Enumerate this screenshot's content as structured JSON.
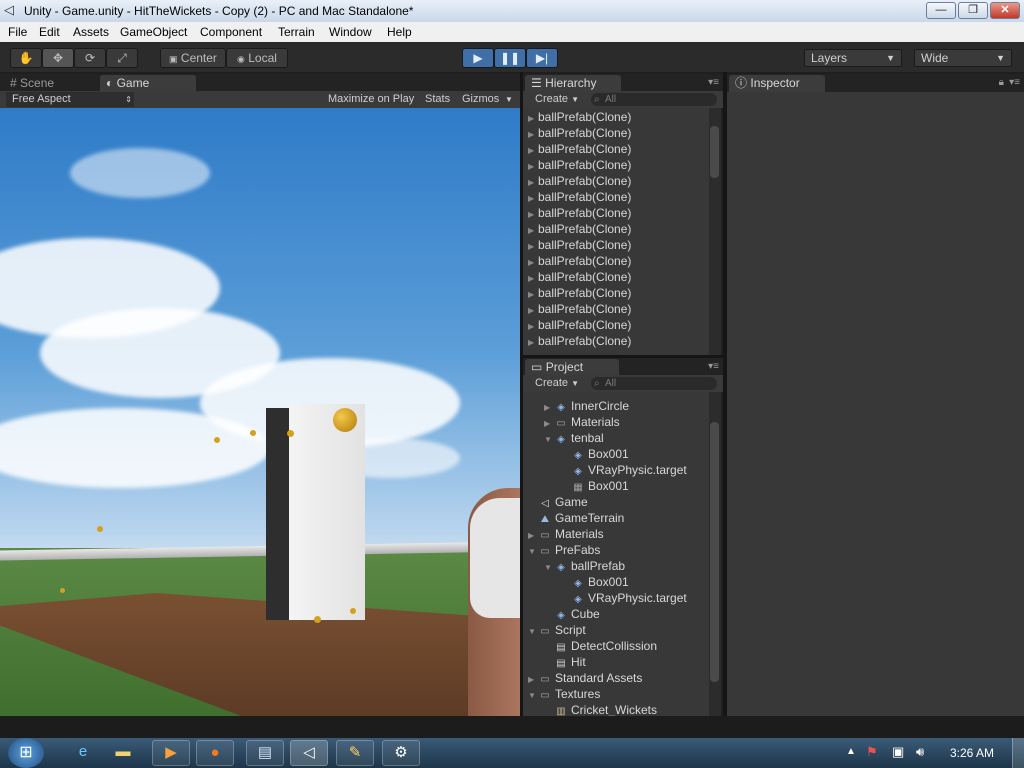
{
  "window": {
    "title": "Unity - Game.unity - HitTheWickets - Copy (2) - PC and Mac Standalone*",
    "min": "—",
    "max": "❐",
    "close": "✕"
  },
  "menu": [
    "File",
    "Edit",
    "Assets",
    "GameObject",
    "Component",
    "Terrain",
    "Window",
    "Help"
  ],
  "toolbar": {
    "center": "Center",
    "local": "Local",
    "layers": "Layers",
    "layout": "Wide"
  },
  "scene_tab": "Scene",
  "game_tab": "Game",
  "game_bar": {
    "aspect": "Free Aspect",
    "maximize": "Maximize on Play",
    "stats": "Stats",
    "gizmos": "Gizmos"
  },
  "hierarchy": {
    "tab": "Hierarchy",
    "create": "Create",
    "search_placeholder": "All",
    "items": [
      "ballPrefab(Clone)",
      "ballPrefab(Clone)",
      "ballPrefab(Clone)",
      "ballPrefab(Clone)",
      "ballPrefab(Clone)",
      "ballPrefab(Clone)",
      "ballPrefab(Clone)",
      "ballPrefab(Clone)",
      "ballPrefab(Clone)",
      "ballPrefab(Clone)",
      "ballPrefab(Clone)",
      "ballPrefab(Clone)",
      "ballPrefab(Clone)",
      "ballPrefab(Clone)",
      "ballPrefab(Clone)"
    ]
  },
  "project": {
    "tab": "Project",
    "create": "Create",
    "search_placeholder": "All",
    "items": [
      {
        "label": "InnerCircle",
        "tri": "▶",
        "icon": "prefab-icon"
      },
      {
        "label": "Materials",
        "tri": "▶",
        "icon": "folder-icon"
      },
      {
        "label": "tenbal",
        "tri": "▼",
        "icon": "prefab-icon"
      },
      {
        "label": "Box001",
        "tri": "",
        "icon": "mesh-icon"
      },
      {
        "label": "VRayPhysic.target",
        "tri": "",
        "icon": "mesh-icon"
      },
      {
        "label": "Box001",
        "tri": "",
        "icon": "grid-icon"
      },
      {
        "label": "Game",
        "tri": "",
        "icon": "unity-scene-icon"
      },
      {
        "label": "GameTerrain",
        "tri": "",
        "icon": "terrain-icon"
      },
      {
        "label": "Materials",
        "tri": "▶",
        "icon": "folder-icon"
      },
      {
        "label": "PreFabs",
        "tri": "▼",
        "icon": "folder-icon"
      },
      {
        "label": "ballPrefab",
        "tri": "▼",
        "icon": "prefab-icon"
      },
      {
        "label": "Box001",
        "tri": "",
        "icon": "mesh-icon"
      },
      {
        "label": "VRayPhysic.target",
        "tri": "",
        "icon": "mesh-icon"
      },
      {
        "label": "Cube",
        "tri": "",
        "icon": "prefab-icon"
      },
      {
        "label": "Script",
        "tri": "▼",
        "icon": "folder-icon"
      },
      {
        "label": "DetectCollission",
        "tri": "",
        "icon": "script-icon"
      },
      {
        "label": "Hit",
        "tri": "",
        "icon": "script-icon"
      },
      {
        "label": "Standard Assets",
        "tri": "▶",
        "icon": "folder-icon"
      },
      {
        "label": "Textures",
        "tri": "▼",
        "icon": "folder-icon"
      },
      {
        "label": "Cricket_Wickets",
        "tri": "",
        "icon": "texture-icon"
      }
    ]
  },
  "inspector": {
    "tab": "Inspector"
  },
  "taskbar": {
    "clock": "3:26 AM"
  }
}
